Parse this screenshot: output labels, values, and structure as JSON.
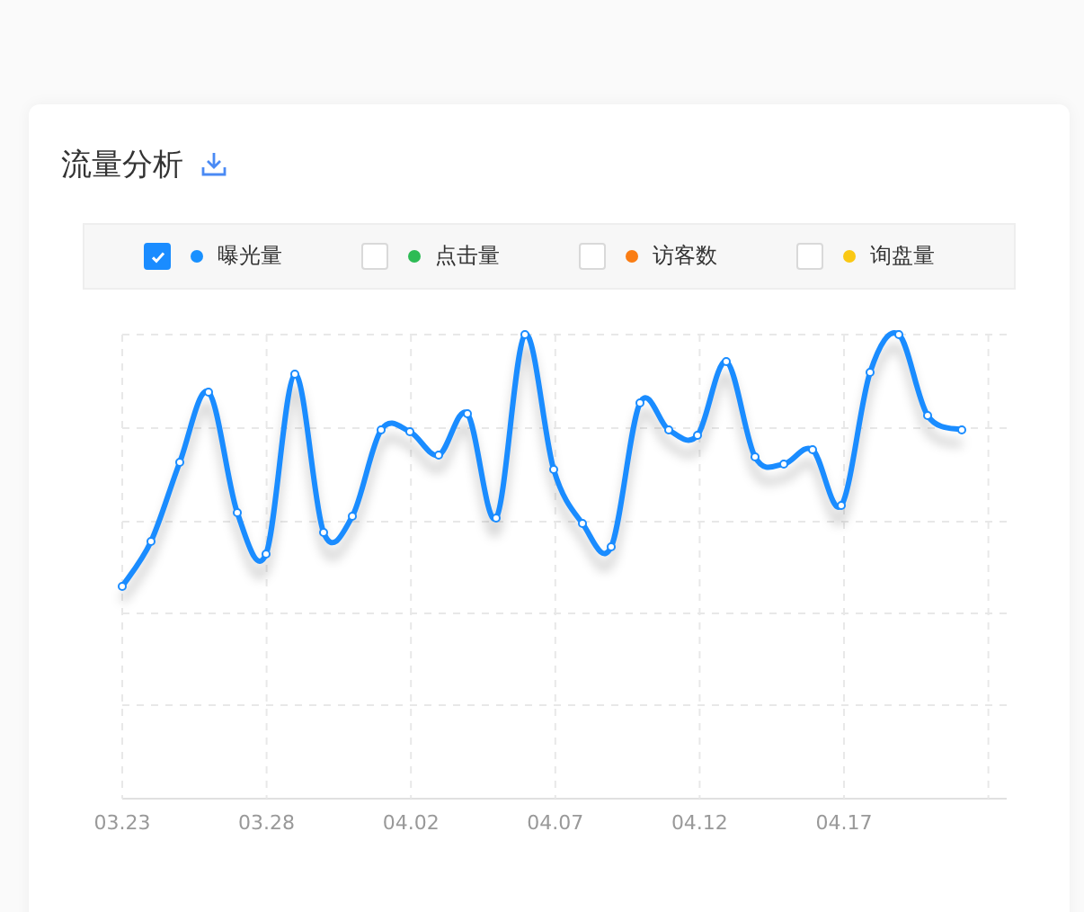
{
  "card": {
    "title": "流量分析"
  },
  "legend": [
    {
      "label": "曝光量",
      "checked": true,
      "color": "#1890ff"
    },
    {
      "label": "点击量",
      "checked": false,
      "color": "#2dbb55"
    },
    {
      "label": "访客数",
      "checked": false,
      "color": "#fa7d14"
    },
    {
      "label": "询盘量",
      "checked": false,
      "color": "#fac814"
    }
  ],
  "chart": {
    "x_axis_labels": [
      "03.23",
      "03.28",
      "04.02",
      "04.07",
      "04.12",
      "04.17"
    ]
  }
}
